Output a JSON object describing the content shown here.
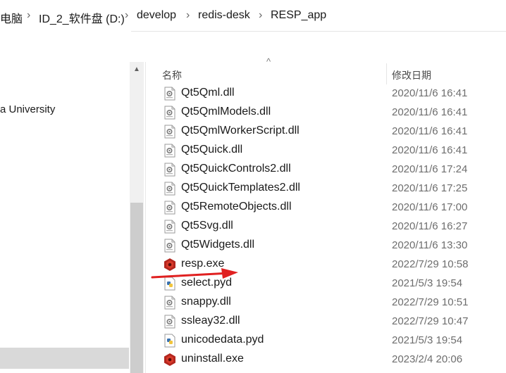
{
  "breadcrumb": {
    "items": [
      "电脑",
      "ID_2_软件盘 (D:)",
      "develop",
      "redis-desk",
      "RESP_app"
    ],
    "separator": "›"
  },
  "nav": {
    "items": [
      {
        "label": "a University"
      }
    ]
  },
  "columns": {
    "name": "名称",
    "date_modified": "修改日期"
  },
  "files": [
    {
      "name": "Qt5Qml.dll",
      "date": "2020/11/6 16:41",
      "icon": "dll-file-icon"
    },
    {
      "name": "Qt5QmlModels.dll",
      "date": "2020/11/6 16:41",
      "icon": "dll-file-icon"
    },
    {
      "name": "Qt5QmlWorkerScript.dll",
      "date": "2020/11/6 16:41",
      "icon": "dll-file-icon"
    },
    {
      "name": "Qt5Quick.dll",
      "date": "2020/11/6 16:41",
      "icon": "dll-file-icon"
    },
    {
      "name": "Qt5QuickControls2.dll",
      "date": "2020/11/6 17:24",
      "icon": "dll-file-icon"
    },
    {
      "name": "Qt5QuickTemplates2.dll",
      "date": "2020/11/6 17:25",
      "icon": "dll-file-icon"
    },
    {
      "name": "Qt5RemoteObjects.dll",
      "date": "2020/11/6 17:00",
      "icon": "dll-file-icon"
    },
    {
      "name": "Qt5Svg.dll",
      "date": "2020/11/6 16:27",
      "icon": "dll-file-icon"
    },
    {
      "name": "Qt5Widgets.dll",
      "date": "2020/11/6 13:30",
      "icon": "dll-file-icon"
    },
    {
      "name": "resp.exe",
      "date": "2022/7/29 10:58",
      "icon": "redis-exe-icon"
    },
    {
      "name": "select.pyd",
      "date": "2021/5/3 19:54",
      "icon": "python-file-icon"
    },
    {
      "name": "snappy.dll",
      "date": "2022/7/29 10:51",
      "icon": "dll-file-icon"
    },
    {
      "name": "ssleay32.dll",
      "date": "2022/7/29 10:47",
      "icon": "dll-file-icon"
    },
    {
      "name": "unicodedata.pyd",
      "date": "2021/5/3 19:54",
      "icon": "python-file-icon"
    },
    {
      "name": "uninstall.exe",
      "date": "2023/2/4 20:06",
      "icon": "redis-exe-icon"
    }
  ],
  "annotation": {
    "arrow_color": "#e02020",
    "points_to": "resp.exe"
  }
}
